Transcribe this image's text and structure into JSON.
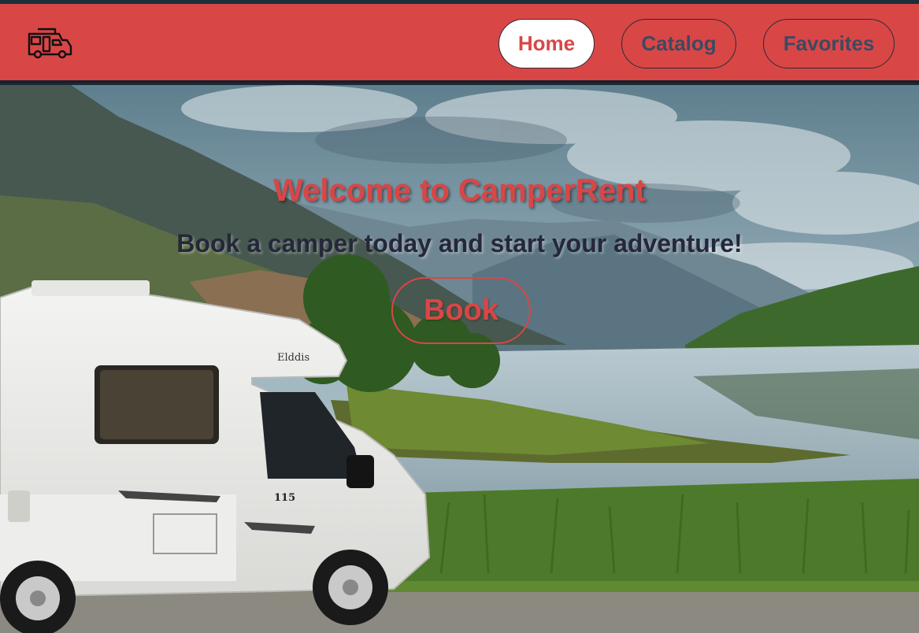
{
  "header": {
    "logo_icon": "camper-van-icon",
    "nav": [
      {
        "label": "Home",
        "active": true
      },
      {
        "label": "Catalog",
        "active": false
      },
      {
        "label": "Favorites",
        "active": false
      }
    ]
  },
  "hero": {
    "title": "Welcome to CamperRent",
    "subtitle": "Book a camper today and start your adventure!",
    "cta_label": "Book",
    "van_brand": "Elddis",
    "van_model": "115"
  },
  "colors": {
    "accent": "#d94646",
    "nav_text": "#3b4a63",
    "dark": "#161f2a"
  }
}
